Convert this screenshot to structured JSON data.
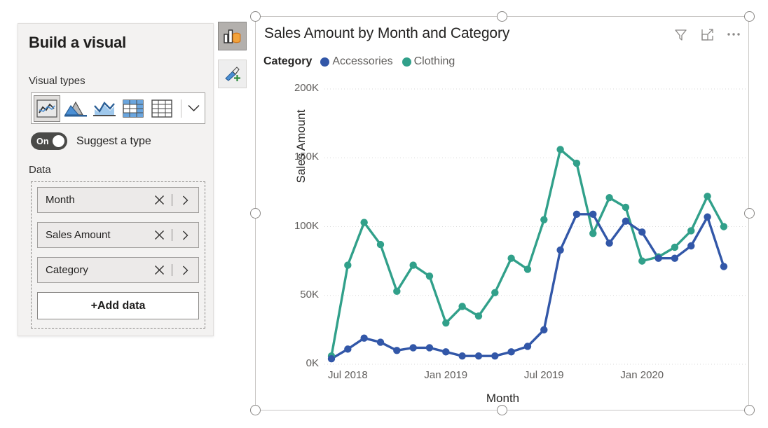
{
  "build_pane": {
    "title": "Build a visual",
    "visual_types_label": "Visual types",
    "visual_types": [
      {
        "name": "line-chart",
        "selected": true
      },
      {
        "name": "area-chart",
        "selected": false
      },
      {
        "name": "line-and-stacked-area-chart",
        "selected": false
      },
      {
        "name": "matrix",
        "selected": false
      },
      {
        "name": "table",
        "selected": false
      }
    ],
    "more_types_icon": "chevron-down-icon",
    "suggest": {
      "state": "On",
      "label": "Suggest a type"
    },
    "data_label": "Data",
    "fields": [
      {
        "name": "Month",
        "remove_icon": "close-icon",
        "menu_icon": "chevron-right-icon"
      },
      {
        "name": "Sales Amount",
        "remove_icon": "close-icon",
        "menu_icon": "chevron-right-icon"
      },
      {
        "name": "Category",
        "remove_icon": "close-icon",
        "menu_icon": "chevron-right-icon"
      }
    ],
    "add_data_label": "+Add data"
  },
  "side_toolbar": [
    {
      "name": "build-visual-icon",
      "active": true
    },
    {
      "name": "format-visual-icon",
      "active": false
    }
  ],
  "visual": {
    "title": "Sales Amount by Month and Category",
    "header_icons": [
      "filter-icon",
      "focus-mode-icon",
      "more-options-icon"
    ],
    "legend": {
      "title": "Category",
      "items": [
        {
          "label": "Accessories",
          "color": "#3257A8"
        },
        {
          "label": "Clothing",
          "color": "#31A08A"
        }
      ]
    }
  },
  "chart_data": {
    "type": "line",
    "title": "Sales Amount by Month and Category",
    "xlabel": "Month",
    "ylabel": "Sales Amount",
    "legend_title": "Category",
    "legend_position": "top",
    "grid": true,
    "ylim": [
      0,
      200000
    ],
    "yticks": [
      0,
      50000,
      100000,
      150000,
      200000
    ],
    "ytick_labels": [
      "0K",
      "50K",
      "100K",
      "150K",
      "200K"
    ],
    "xtick_labels": [
      "Jul 2018",
      "Jan 2019",
      "Jul 2019",
      "Jan 2020"
    ],
    "xtick_indices": [
      1,
      7,
      13,
      19
    ],
    "x": [
      "Jun 2018",
      "Jul 2018",
      "Aug 2018",
      "Sep 2018",
      "Oct 2018",
      "Nov 2018",
      "Dec 2018",
      "Jan 2019",
      "Feb 2019",
      "Mar 2019",
      "Apr 2019",
      "May 2019",
      "Jun 2019",
      "Jul 2019",
      "Aug 2019",
      "Sep 2019",
      "Oct 2019",
      "Nov 2019",
      "Dec 2019",
      "Jan 2020",
      "Feb 2020",
      "Mar 2020",
      "Apr 2020",
      "May 2020",
      "Jun 2020"
    ],
    "series": [
      {
        "name": "Accessories",
        "color": "#3257A8",
        "values": [
          4000,
          11000,
          19000,
          16000,
          10000,
          12000,
          12000,
          9000,
          6000,
          6000,
          6000,
          9000,
          13000,
          25000,
          83000,
          109000,
          109000,
          88000,
          104000,
          96000,
          77000,
          77000,
          86000,
          107000,
          71000
        ]
      },
      {
        "name": "Clothing",
        "color": "#31A08A",
        "values": [
          6000,
          72000,
          103000,
          87000,
          53000,
          72000,
          64000,
          30000,
          42000,
          35000,
          52000,
          77000,
          69000,
          105000,
          156000,
          146000,
          95000,
          121000,
          114000,
          75000,
          78000,
          85000,
          97000,
          122000,
          100000
        ]
      }
    ]
  }
}
